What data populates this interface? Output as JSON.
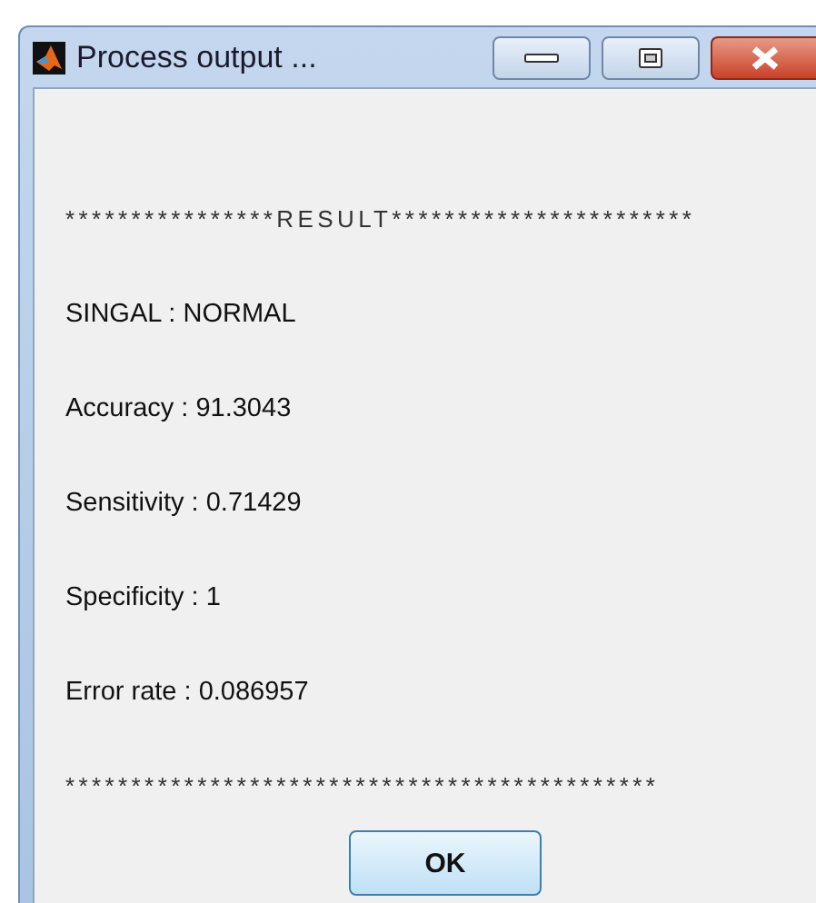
{
  "window": {
    "title": "Process output ..."
  },
  "lines": [
    {
      "kind": "rule",
      "text": "****************RESULT***********************"
    },
    {
      "kind": "text",
      "text": "SINGAL : NORMAL"
    },
    {
      "kind": "text",
      "text": "Accuracy : 91.3043"
    },
    {
      "kind": "text",
      "text": "Sensitivity : 0.71429"
    },
    {
      "kind": "text",
      "text": "Specificity : 1"
    },
    {
      "kind": "text",
      "text": "Error rate : 0.086957"
    },
    {
      "kind": "rule",
      "text": "*********************************************"
    }
  ],
  "buttons": [
    "OK"
  ]
}
